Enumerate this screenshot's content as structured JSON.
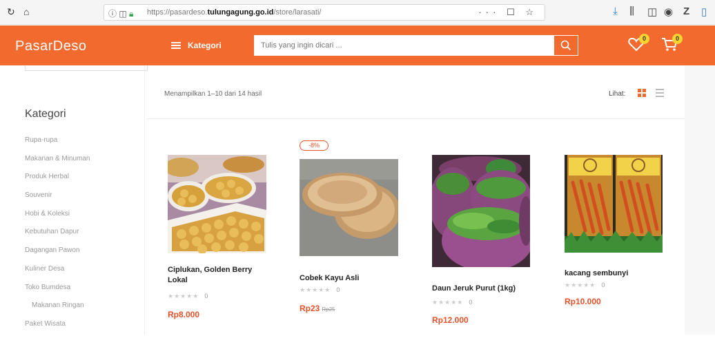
{
  "browser": {
    "url_prefix": "https://pasardeso.",
    "url_domain": "tulungagung.go.id",
    "url_path": "/store/larasati/",
    "url_right_icons": "··· ☐ ☆"
  },
  "header": {
    "logo": "PasarDeso",
    "menu_label": "Kategori",
    "search_placeholder": "Tulis yang ingin dicari ...",
    "wishlist_count": "0",
    "cart_count": "0",
    "accent_color": "#f26a2e"
  },
  "sidebar": {
    "title": "Kategori",
    "items": [
      {
        "label": "Rupa-rupa"
      },
      {
        "label": "Makanan & Minuman"
      },
      {
        "label": "Produk Herbal"
      },
      {
        "label": "Souvenir"
      },
      {
        "label": "Hobi & Koleksi"
      },
      {
        "label": "Kebutuhan Dapur"
      },
      {
        "label": "Dagangan Pawon"
      },
      {
        "label": "Kuliner Desa"
      },
      {
        "label": "Toko Bumdesa"
      },
      {
        "label": "Makanan Ringan"
      },
      {
        "label": "Paket Wisata"
      }
    ]
  },
  "toolbar": {
    "result_count": "Menampilkan 1–10 dari 14 hasil",
    "view_label": "Lihat:"
  },
  "products": [
    {
      "name": "Ciplukan, Golden Berry Lokal",
      "rating": "★★★★★",
      "rating_count": "0",
      "price": "Rp8.000",
      "old_price": "",
      "sale": ""
    },
    {
      "name": "Cobek Kayu Asli",
      "rating": "★★★★★",
      "rating_count": "0",
      "price": "Rp23",
      "old_price": "Rp25",
      "sale": "-8%"
    },
    {
      "name": "Daun Jeruk Purut (1kg)",
      "rating": "★★★★★",
      "rating_count": "0",
      "price": "Rp12.000",
      "old_price": "",
      "sale": ""
    },
    {
      "name": "kacang sembunyi",
      "rating": "★★★★★",
      "rating_count": "0",
      "price": "Rp10.000",
      "old_price": "",
      "sale": ""
    }
  ]
}
